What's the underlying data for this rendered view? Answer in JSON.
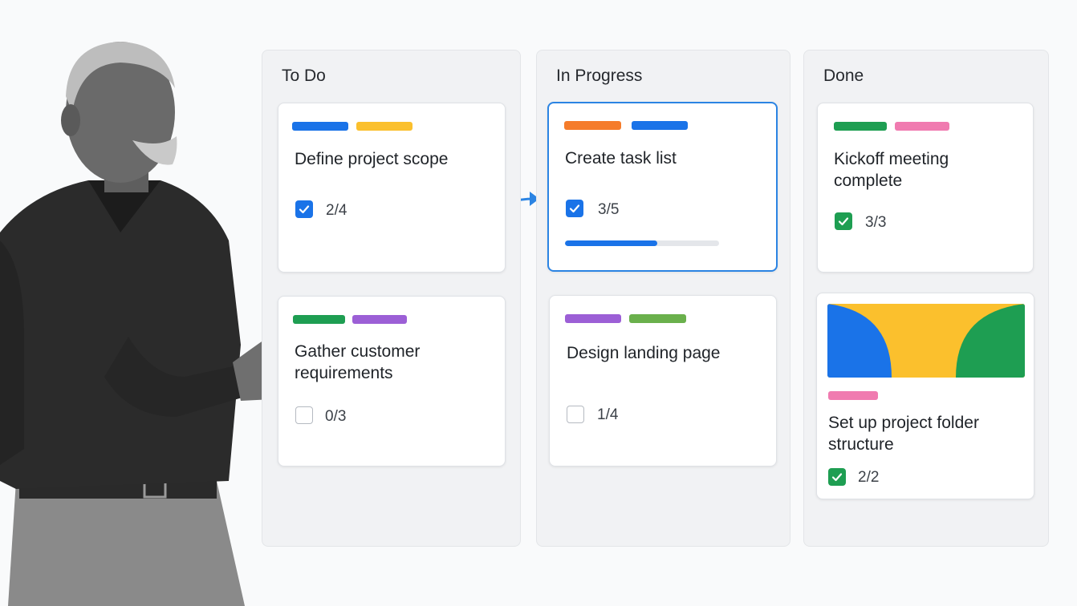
{
  "board": {
    "columns": [
      {
        "title": "To Do",
        "cards": [
          {
            "title": "Define project scope",
            "labels": [
              "#1a73e8",
              "#fbc02d"
            ],
            "checklist": "2/4",
            "checked": true
          },
          {
            "title": "Gather customer requirements",
            "labels": [
              "#1e9e52",
              "#9c5fd6"
            ],
            "checklist": "0/3",
            "checked": false
          }
        ]
      },
      {
        "title": "In Progress",
        "cards": [
          {
            "title": "Create task list",
            "labels": [
              "#f57c2b",
              "#1a73e8"
            ],
            "checklist": "3/5",
            "checked": true,
            "progress": 0.6,
            "active": true
          },
          {
            "title": "Design landing page",
            "labels": [
              "#9c5fd6",
              "#6ab04c"
            ],
            "checklist": "1/4",
            "checked": false
          }
        ]
      },
      {
        "title": "Done",
        "cards": [
          {
            "title": "Kickoff meeting complete",
            "labels": [
              "#1e9e52",
              "#f07bb0"
            ],
            "checklist": "3/3",
            "checked": true
          },
          {
            "title": "Set up project folder structure",
            "labels": [
              "#f07bb0"
            ],
            "checklist": "2/2",
            "checked": true,
            "cover": [
              "#1a73e8",
              "#fbc02d",
              "#1e9e52"
            ]
          }
        ]
      }
    ]
  },
  "colors": {
    "accent": "#1a73e8",
    "done_green": "#1e9e52"
  },
  "icons": {
    "checkmark": "check-icon",
    "move": "curved-arrow-icon",
    "presenter": "presenter-figure"
  }
}
